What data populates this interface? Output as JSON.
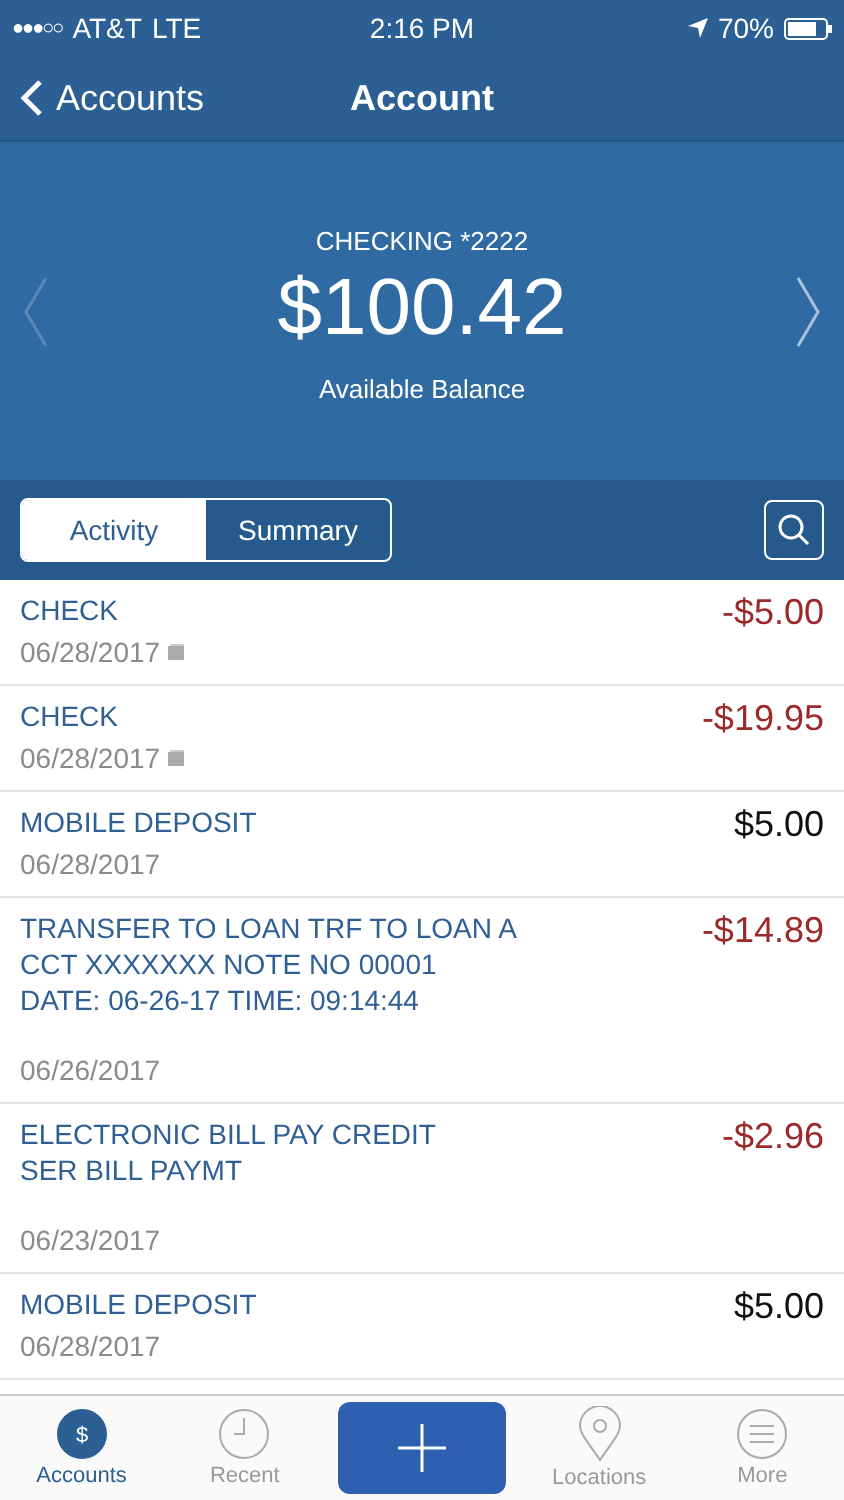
{
  "status_bar": {
    "signal": "●●●○○",
    "carrier": "AT&T",
    "network": "LTE",
    "time": "2:16 PM",
    "battery": "70%"
  },
  "nav": {
    "back_label": "Accounts",
    "title": "Account"
  },
  "balance": {
    "account": "CHECKING *2222",
    "amount": "$100.42",
    "caption": "Available Balance"
  },
  "tabs": [
    {
      "label": "Activity",
      "selected": true
    },
    {
      "label": "Summary",
      "selected": false
    }
  ],
  "transactions": [
    {
      "description": "CHECK",
      "date": "06/28/2017",
      "amount": "-$5.00",
      "debit": true,
      "has_image": true
    },
    {
      "description": "CHECK",
      "date": "06/28/2017",
      "amount": "-$19.95",
      "debit": true,
      "has_image": true
    },
    {
      "description": "MOBILE DEPOSIT",
      "date": "06/28/2017",
      "amount": "$5.00",
      "debit": false,
      "has_image": false
    },
    {
      "description": "TRANSFER TO LOAN TRF TO LOAN A\nCCT XXXXXXX NOTE NO 00001\nDATE: 06-26-17 TIME: 09:14:44",
      "date": "06/26/2017",
      "amount": "-$14.89",
      "debit": true,
      "has_image": false
    },
    {
      "description": "ELECTRONIC BILL PAY CREDIT\nSER BILL PAYMT",
      "date": "06/23/2017",
      "amount": "-$2.96",
      "debit": true,
      "has_image": false
    },
    {
      "description": "MOBILE DEPOSIT",
      "date": "06/28/2017",
      "amount": "$5.00",
      "debit": false,
      "has_image": false
    }
  ],
  "bottom_tabs": [
    {
      "label": "Accounts",
      "kind": "accounts",
      "badge": "$",
      "selected": true
    },
    {
      "label": "Recent",
      "kind": "recent",
      "selected": false
    },
    {
      "label": "Locations",
      "kind": "locations",
      "selected": false
    },
    {
      "label": "More",
      "kind": "more",
      "selected": false
    }
  ]
}
